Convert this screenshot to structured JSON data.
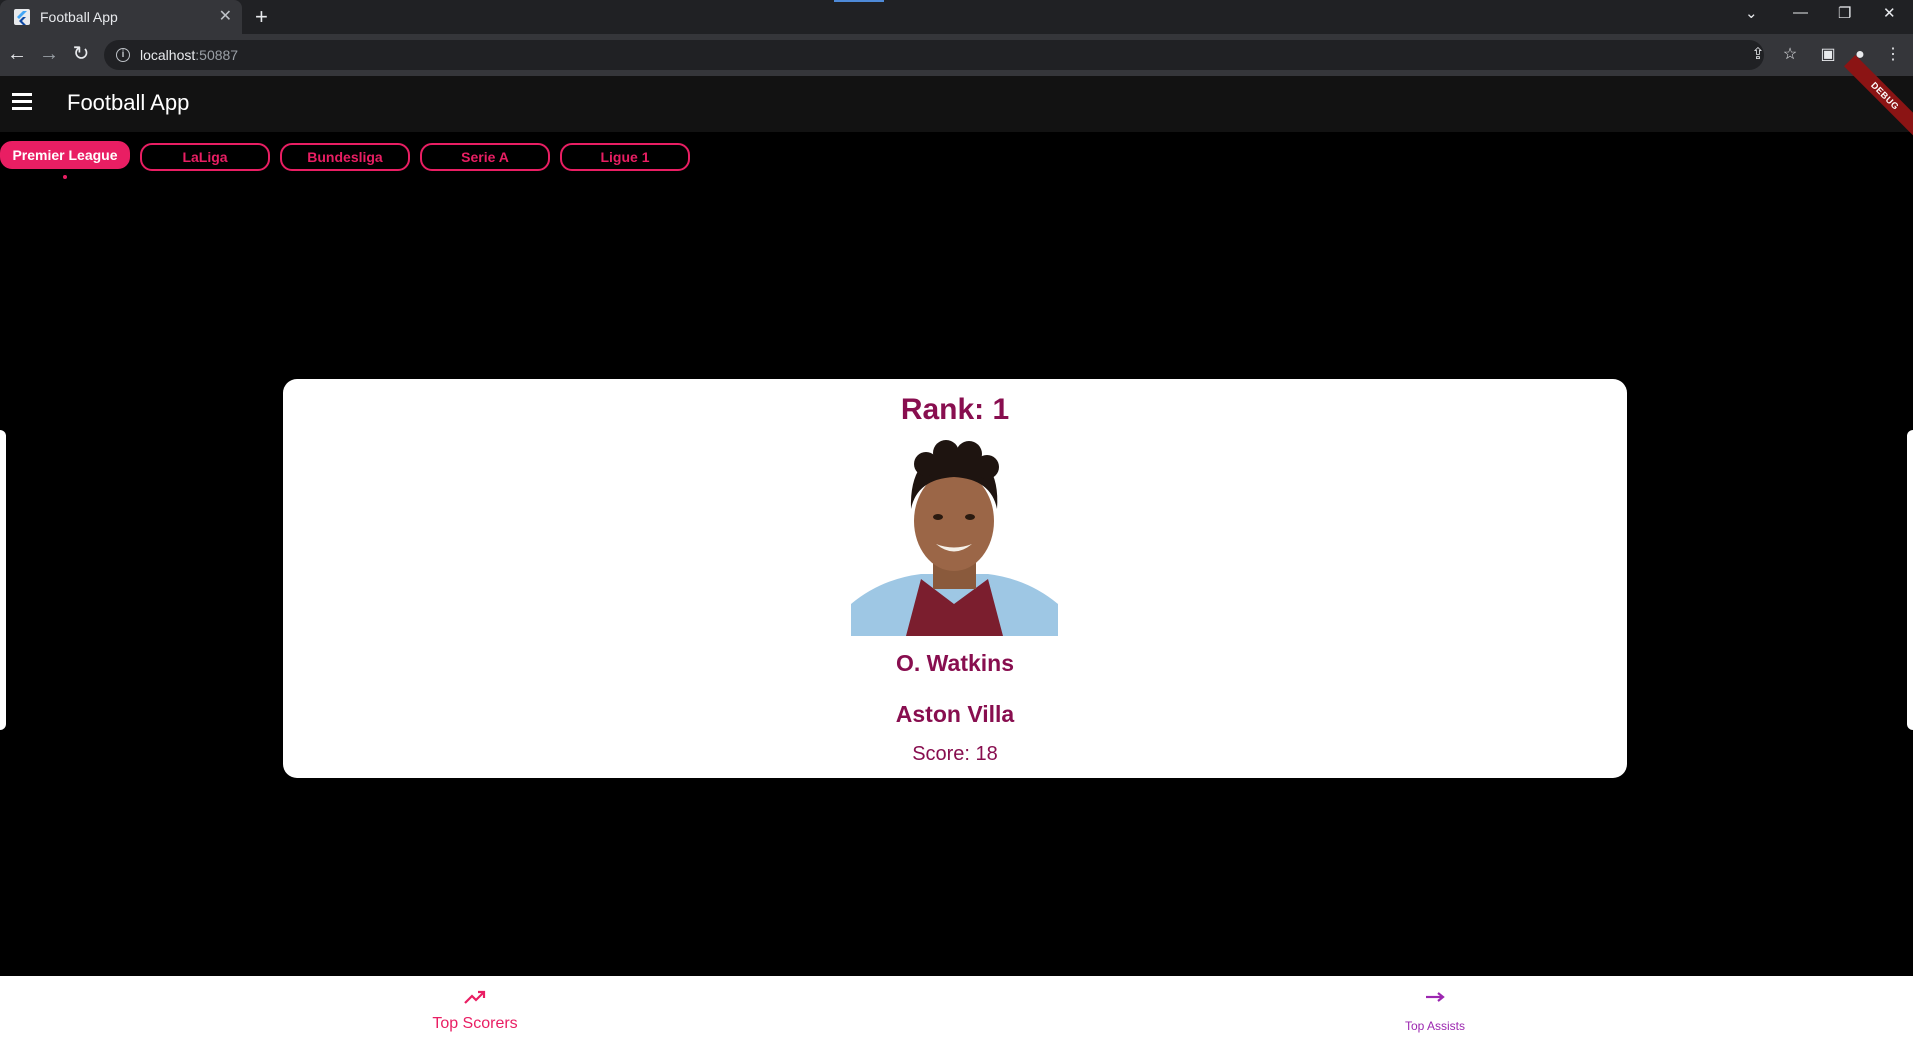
{
  "browser": {
    "tab_title": "Football App",
    "url_host": "localhost",
    "url_port": ":50887"
  },
  "appbar": {
    "title": "Football App",
    "debug_label": "DEBUG"
  },
  "leagues": [
    {
      "label": "Premier League",
      "active": true
    },
    {
      "label": "LaLiga",
      "active": false
    },
    {
      "label": "Bundesliga",
      "active": false
    },
    {
      "label": "Serie A",
      "active": false
    },
    {
      "label": "Ligue 1",
      "active": false
    }
  ],
  "card": {
    "rank": "Rank: 1",
    "player_name": "O. Watkins",
    "team": "Aston Villa",
    "score": "Score: 18"
  },
  "bottom_nav": {
    "items": [
      {
        "label": "Top Scorers",
        "icon": "trending-up-icon",
        "selected": true
      },
      {
        "label": "Top Assists",
        "icon": "arrow-right-icon",
        "selected": false
      }
    ]
  },
  "colors": {
    "accent": "#e91e63",
    "text_primary": "#880e4f",
    "unselected_nav": "#9c27b0"
  }
}
